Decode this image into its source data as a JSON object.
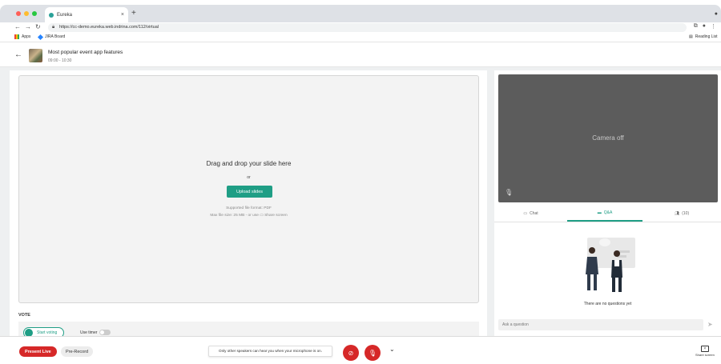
{
  "browser": {
    "tab_title": "Eureka",
    "tab_close": "×",
    "new_tab": "+",
    "url": "https://cc-demo.eureka.web.indrina.com/112/virtual",
    "bookmarks": [
      {
        "label": "Apps"
      },
      {
        "label": "JIRA Board"
      }
    ],
    "reading_list": "Reading List"
  },
  "event": {
    "title": "Most popular event app features",
    "time": "09:00 - 10:30"
  },
  "dropzone": {
    "title": "Drag and drop your slide here",
    "or": "or",
    "upload_button": "Upload slides",
    "format_info": "Supported file format: PDF",
    "size_info": "Max file size: 25 MB - or use ▭ Share screen"
  },
  "vote": {
    "label": "VOTE",
    "start_button": "Start voting",
    "timer_label": "Use timer"
  },
  "camera": {
    "status": "Camera off"
  },
  "panel_tabs": [
    {
      "label": "Chat",
      "icon": "chat-icon",
      "active": false
    },
    {
      "label": "Q&A",
      "icon": "qa-icon",
      "active": true
    },
    {
      "label": "(10)",
      "icon": "people-icon",
      "active": false
    }
  ],
  "qa": {
    "empty_message": "There are no questions yet",
    "input_placeholder": "Ask a question"
  },
  "bottom": {
    "present_live": "Present Live",
    "pre_record": "Pre-Record",
    "mic_notice": "Only other speakers can hear you when your microphone is on.",
    "more": "⌄",
    "share_screen": "Share screen"
  },
  "colors": {
    "accent": "#1f9e85",
    "live_red": "#d62828",
    "camera_bg": "#5c5c5c"
  }
}
